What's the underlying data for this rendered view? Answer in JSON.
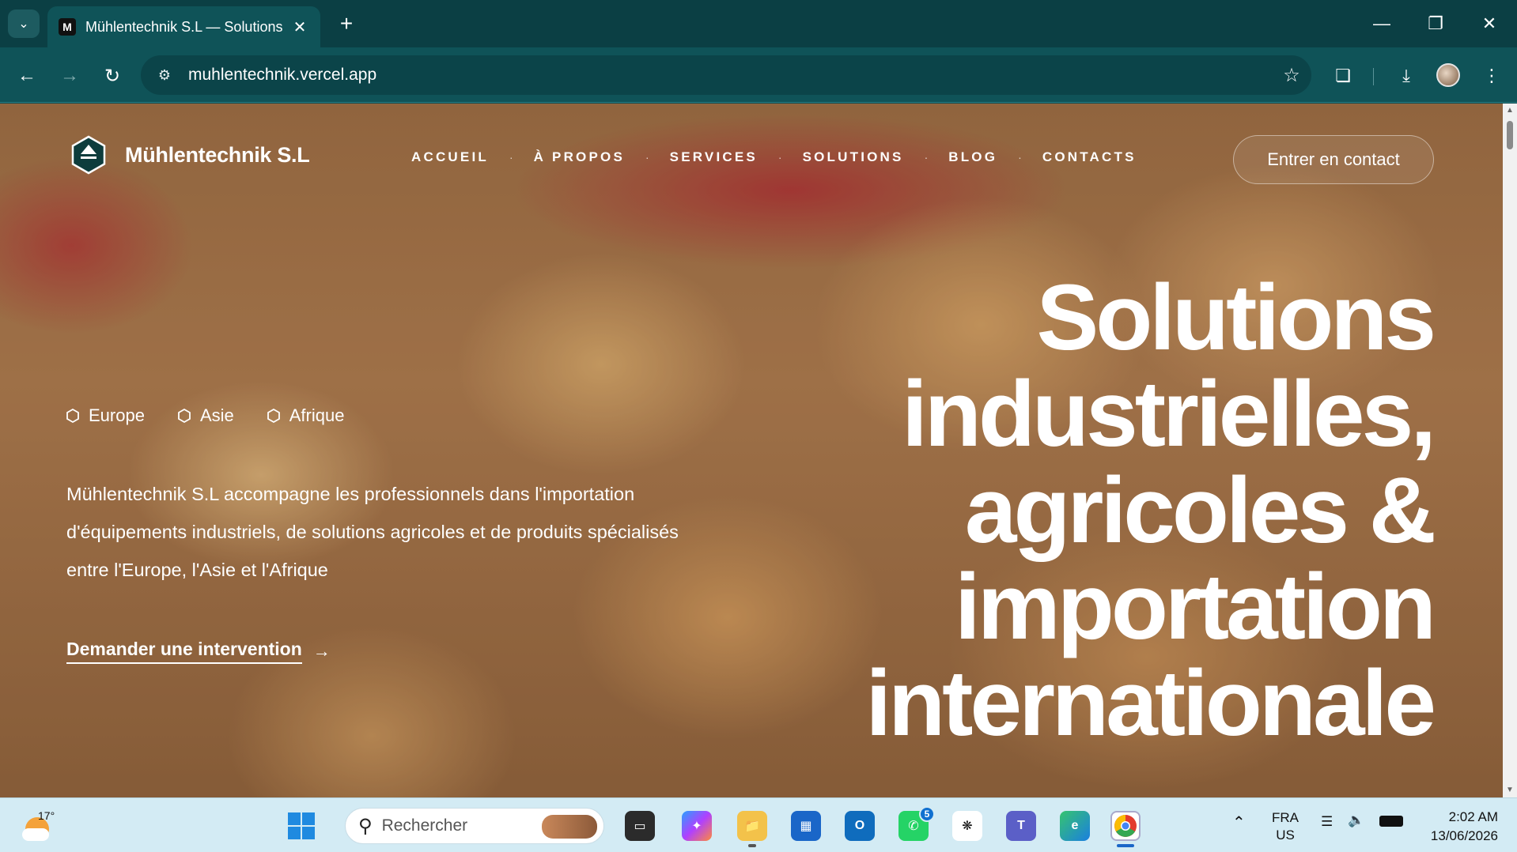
{
  "browser": {
    "tab_title": "Mühlentechnik S.L — Solutions",
    "favicon_letter": "M",
    "url": "muhlentechnik.vercel.app"
  },
  "site": {
    "brand": "Mühlentechnik S.L",
    "nav": [
      "ACCUEIL",
      "À PROPOS",
      "SERVICES",
      "SOLUTIONS",
      "BLOG",
      "CONTACTS"
    ],
    "cta": "Entrer en contact",
    "regions": [
      "Europe",
      "Asie",
      "Afrique"
    ],
    "intro": "Mühlentechnik S.L accompagne les professionnels dans l'importation d'équipements industriels, de solutions agricoles et de produits spécialisés entre l'Europe, l'Asie et l'Afrique",
    "intervention": "Demander une intervention",
    "headline": [
      "Solutions",
      "industrielles,",
      "agricoles &",
      "importation",
      "internationale"
    ]
  },
  "taskbar": {
    "temperature": "17°",
    "search_placeholder": "Rechercher",
    "whatsapp_badge": "5",
    "lang_line1": "FRA",
    "lang_line2": "US",
    "time": "2:02 AM",
    "date": "13/06/2026"
  },
  "colors": {
    "chrome_dark": "#0b3f44",
    "chrome": "#0f5358",
    "taskbar": "#d3ebf4"
  }
}
